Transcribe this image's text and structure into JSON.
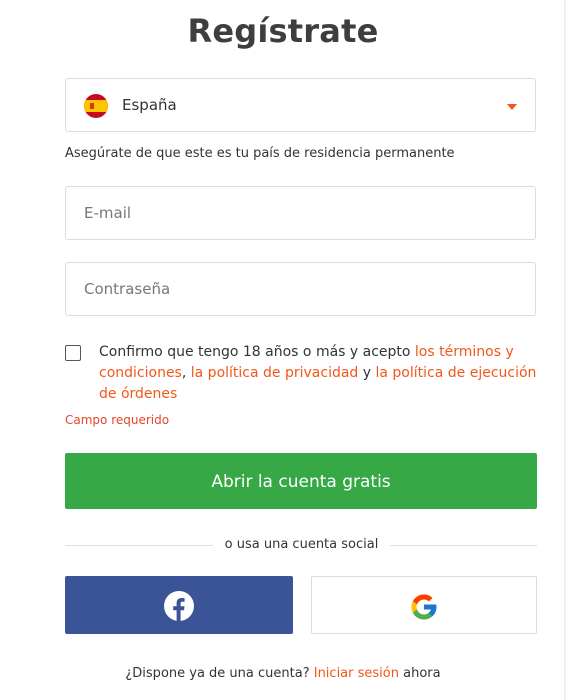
{
  "title": "Regístrate",
  "country": {
    "selected": "España",
    "flag_icon": "spain-flag-icon",
    "hint": "Asegúrate de que este es tu país de residencia permanente"
  },
  "email": {
    "placeholder": "E-mail",
    "value": ""
  },
  "password": {
    "placeholder": "Contraseña",
    "value": ""
  },
  "consent": {
    "checked": false,
    "text_start": "Confirmo que tengo 18 años o más y acepto ",
    "terms_link": "los términos y condiciones",
    "comma": ", ",
    "privacy_link": "la política de privacidad",
    "and": " y ",
    "execution_link": "la política de ejecución de órdenes",
    "error": "Campo requerido"
  },
  "submit_label": "Abrir la cuenta gratis",
  "social": {
    "divider_text": "o usa una cuenta social",
    "facebook_icon": "facebook-icon",
    "google_icon": "google-icon"
  },
  "login": {
    "question": "¿Dispone ya de una cuenta? ",
    "link": "Iniciar sesión",
    "suffix": " ahora"
  },
  "colors": {
    "accent": "#f2571a",
    "primary_button": "#36a846",
    "facebook": "#3b5498",
    "error": "#e5452b"
  }
}
